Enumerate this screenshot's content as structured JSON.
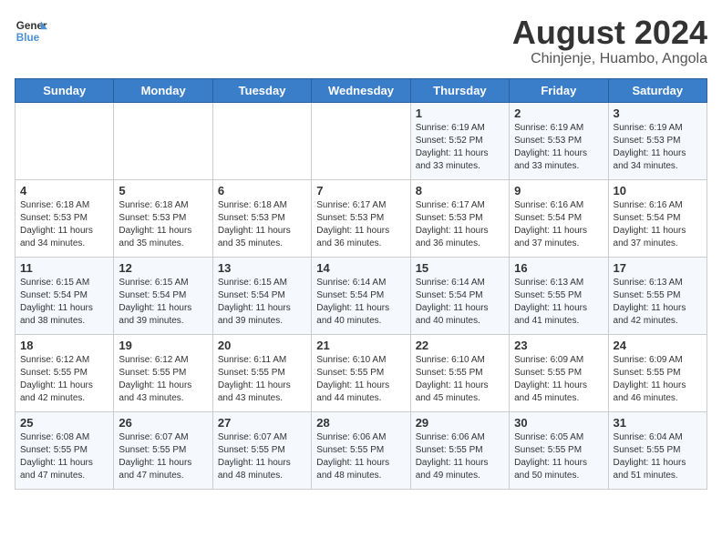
{
  "logo": {
    "line1": "General",
    "line2": "Blue"
  },
  "title": "August 2024",
  "location": "Chinjenje, Huambo, Angola",
  "days_of_week": [
    "Sunday",
    "Monday",
    "Tuesday",
    "Wednesday",
    "Thursday",
    "Friday",
    "Saturday"
  ],
  "weeks": [
    [
      {
        "day": "",
        "info": ""
      },
      {
        "day": "",
        "info": ""
      },
      {
        "day": "",
        "info": ""
      },
      {
        "day": "",
        "info": ""
      },
      {
        "day": "1",
        "info": "Sunrise: 6:19 AM\nSunset: 5:52 PM\nDaylight: 11 hours\nand 33 minutes."
      },
      {
        "day": "2",
        "info": "Sunrise: 6:19 AM\nSunset: 5:53 PM\nDaylight: 11 hours\nand 33 minutes."
      },
      {
        "day": "3",
        "info": "Sunrise: 6:19 AM\nSunset: 5:53 PM\nDaylight: 11 hours\nand 34 minutes."
      }
    ],
    [
      {
        "day": "4",
        "info": "Sunrise: 6:18 AM\nSunset: 5:53 PM\nDaylight: 11 hours\nand 34 minutes."
      },
      {
        "day": "5",
        "info": "Sunrise: 6:18 AM\nSunset: 5:53 PM\nDaylight: 11 hours\nand 35 minutes."
      },
      {
        "day": "6",
        "info": "Sunrise: 6:18 AM\nSunset: 5:53 PM\nDaylight: 11 hours\nand 35 minutes."
      },
      {
        "day": "7",
        "info": "Sunrise: 6:17 AM\nSunset: 5:53 PM\nDaylight: 11 hours\nand 36 minutes."
      },
      {
        "day": "8",
        "info": "Sunrise: 6:17 AM\nSunset: 5:53 PM\nDaylight: 11 hours\nand 36 minutes."
      },
      {
        "day": "9",
        "info": "Sunrise: 6:16 AM\nSunset: 5:54 PM\nDaylight: 11 hours\nand 37 minutes."
      },
      {
        "day": "10",
        "info": "Sunrise: 6:16 AM\nSunset: 5:54 PM\nDaylight: 11 hours\nand 37 minutes."
      }
    ],
    [
      {
        "day": "11",
        "info": "Sunrise: 6:15 AM\nSunset: 5:54 PM\nDaylight: 11 hours\nand 38 minutes."
      },
      {
        "day": "12",
        "info": "Sunrise: 6:15 AM\nSunset: 5:54 PM\nDaylight: 11 hours\nand 39 minutes."
      },
      {
        "day": "13",
        "info": "Sunrise: 6:15 AM\nSunset: 5:54 PM\nDaylight: 11 hours\nand 39 minutes."
      },
      {
        "day": "14",
        "info": "Sunrise: 6:14 AM\nSunset: 5:54 PM\nDaylight: 11 hours\nand 40 minutes."
      },
      {
        "day": "15",
        "info": "Sunrise: 6:14 AM\nSunset: 5:54 PM\nDaylight: 11 hours\nand 40 minutes."
      },
      {
        "day": "16",
        "info": "Sunrise: 6:13 AM\nSunset: 5:55 PM\nDaylight: 11 hours\nand 41 minutes."
      },
      {
        "day": "17",
        "info": "Sunrise: 6:13 AM\nSunset: 5:55 PM\nDaylight: 11 hours\nand 42 minutes."
      }
    ],
    [
      {
        "day": "18",
        "info": "Sunrise: 6:12 AM\nSunset: 5:55 PM\nDaylight: 11 hours\nand 42 minutes."
      },
      {
        "day": "19",
        "info": "Sunrise: 6:12 AM\nSunset: 5:55 PM\nDaylight: 11 hours\nand 43 minutes."
      },
      {
        "day": "20",
        "info": "Sunrise: 6:11 AM\nSunset: 5:55 PM\nDaylight: 11 hours\nand 43 minutes."
      },
      {
        "day": "21",
        "info": "Sunrise: 6:10 AM\nSunset: 5:55 PM\nDaylight: 11 hours\nand 44 minutes."
      },
      {
        "day": "22",
        "info": "Sunrise: 6:10 AM\nSunset: 5:55 PM\nDaylight: 11 hours\nand 45 minutes."
      },
      {
        "day": "23",
        "info": "Sunrise: 6:09 AM\nSunset: 5:55 PM\nDaylight: 11 hours\nand 45 minutes."
      },
      {
        "day": "24",
        "info": "Sunrise: 6:09 AM\nSunset: 5:55 PM\nDaylight: 11 hours\nand 46 minutes."
      }
    ],
    [
      {
        "day": "25",
        "info": "Sunrise: 6:08 AM\nSunset: 5:55 PM\nDaylight: 11 hours\nand 47 minutes."
      },
      {
        "day": "26",
        "info": "Sunrise: 6:07 AM\nSunset: 5:55 PM\nDaylight: 11 hours\nand 47 minutes."
      },
      {
        "day": "27",
        "info": "Sunrise: 6:07 AM\nSunset: 5:55 PM\nDaylight: 11 hours\nand 48 minutes."
      },
      {
        "day": "28",
        "info": "Sunrise: 6:06 AM\nSunset: 5:55 PM\nDaylight: 11 hours\nand 48 minutes."
      },
      {
        "day": "29",
        "info": "Sunrise: 6:06 AM\nSunset: 5:55 PM\nDaylight: 11 hours\nand 49 minutes."
      },
      {
        "day": "30",
        "info": "Sunrise: 6:05 AM\nSunset: 5:55 PM\nDaylight: 11 hours\nand 50 minutes."
      },
      {
        "day": "31",
        "info": "Sunrise: 6:04 AM\nSunset: 5:55 PM\nDaylight: 11 hours\nand 51 minutes."
      }
    ]
  ]
}
